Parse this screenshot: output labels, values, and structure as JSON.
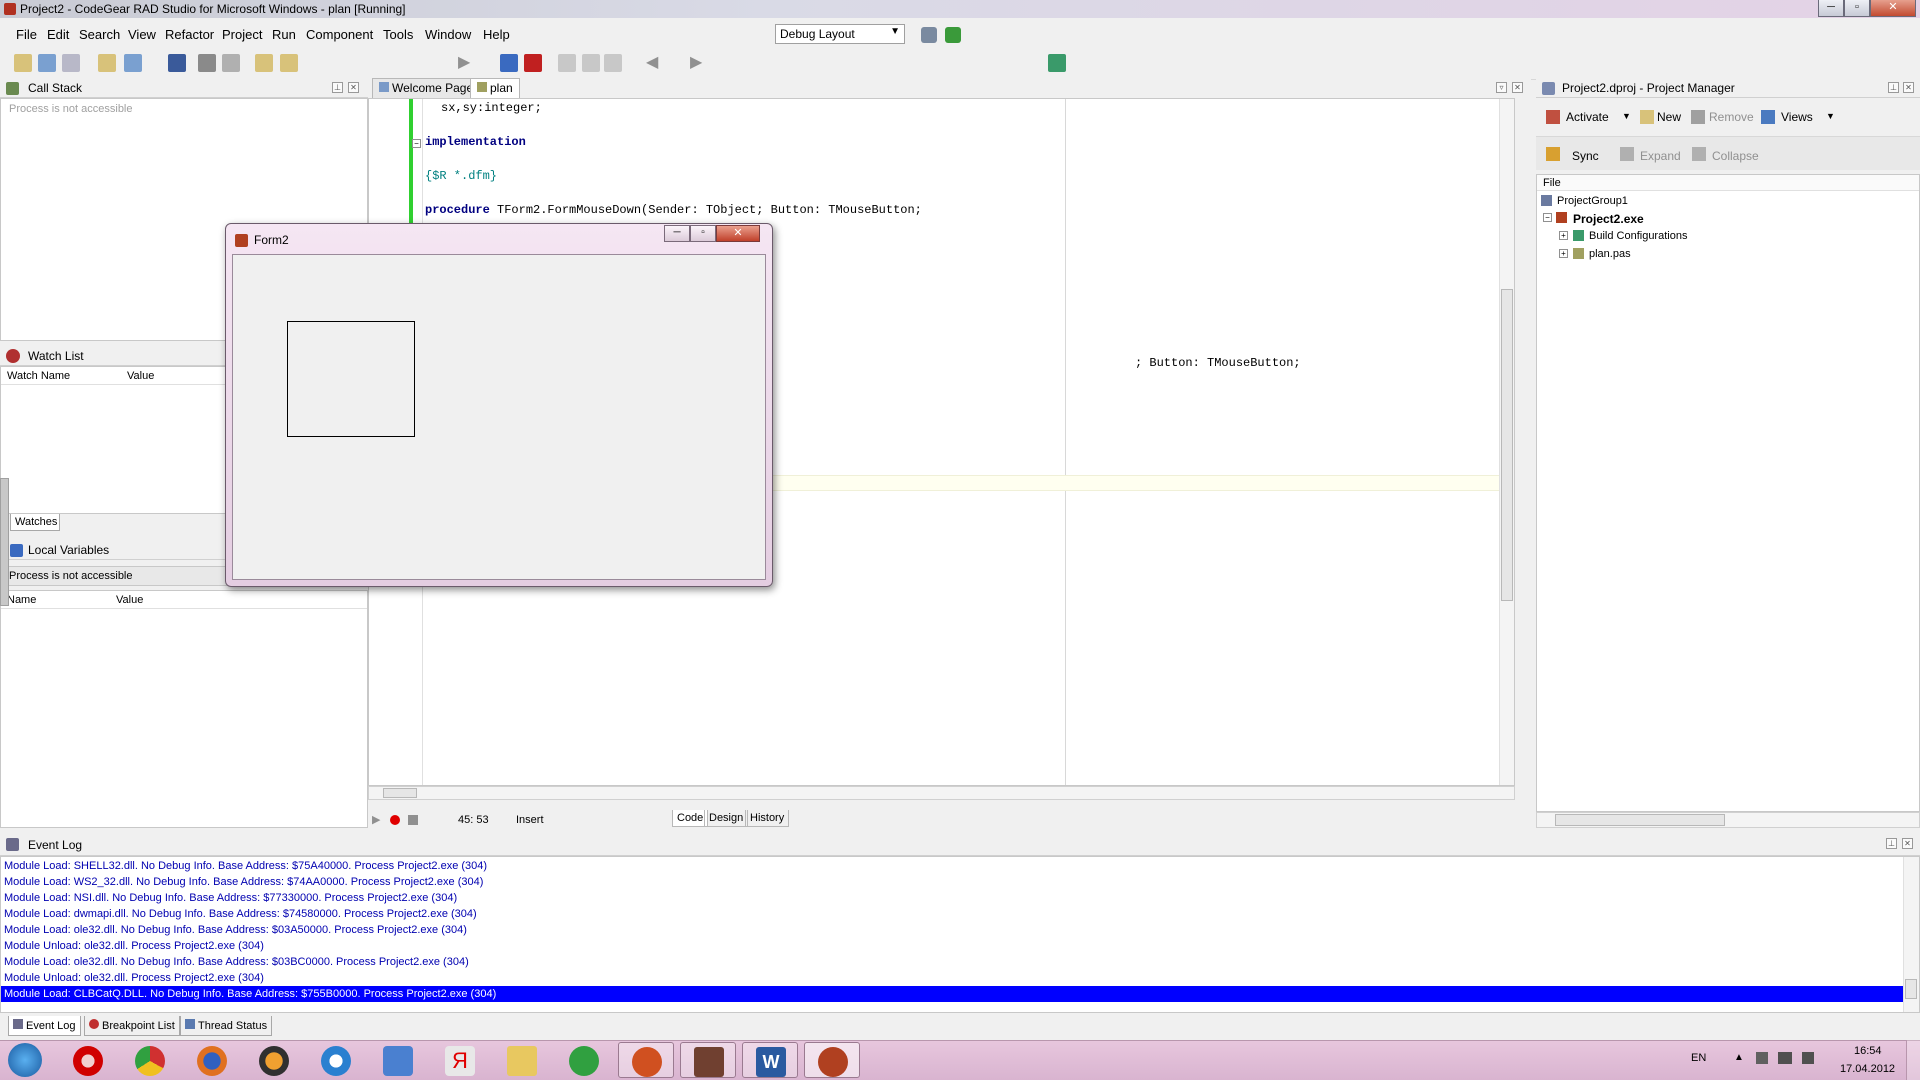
{
  "app": {
    "title": "Project2 - CodeGear RAD Studio for Microsoft Windows - plan [Running]"
  },
  "menu": [
    "File",
    "Edit",
    "Search",
    "View",
    "Refactor",
    "Project",
    "Run",
    "Component",
    "Tools",
    "Window",
    "Help"
  ],
  "toolbar": {
    "layout_select": "Debug Layout"
  },
  "call_stack": {
    "title": "Call Stack",
    "status": "Process is not accessible"
  },
  "watch_list": {
    "title": "Watch List",
    "columns": [
      "Watch Name",
      "Value"
    ],
    "tab": "Watches"
  },
  "local_vars": {
    "title": "Local Variables",
    "status": "Process is not accessible",
    "columns": [
      "Name",
      "Value"
    ]
  },
  "editor": {
    "tabs": [
      "Welcome Page",
      "plan"
    ],
    "code": {
      "line1": "sx,sy:integer;",
      "line2": "implementation",
      "line3": "{$R *.dfm}",
      "line4_kw": "procedure",
      "line4_rest": " TForm2.FormMouseDown(Sender: TObject; Button: TMouseButton;",
      "line5": "; Button: TMouseButton;"
    },
    "status": {
      "position": "45: 53",
      "mode": "Insert"
    },
    "view_tabs": [
      "Code",
      "Design",
      "History"
    ]
  },
  "form2": {
    "title": "Form2"
  },
  "project_manager": {
    "title": "Project2.dproj - Project Manager",
    "buttons": [
      "Activate",
      "New",
      "Remove",
      "Views"
    ],
    "buttons2": [
      "Sync",
      "Expand",
      "Collapse"
    ],
    "column": "File",
    "tree": [
      "ProjectGroup1",
      "Project2.exe",
      "Build Configurations",
      "plan.pas"
    ]
  },
  "event_log": {
    "title": "Event Log",
    "lines": [
      "Module Load: SHELL32.dll. No Debug Info. Base Address: $75A40000. Process Project2.exe (304)",
      "Module Load: WS2_32.dll. No Debug Info. Base Address: $74AA0000. Process Project2.exe (304)",
      "Module Load: NSI.dll. No Debug Info. Base Address: $77330000. Process Project2.exe (304)",
      "Module Load: dwmapi.dll. No Debug Info. Base Address: $74580000. Process Project2.exe (304)",
      "Module Load: ole32.dll. No Debug Info. Base Address: $03A50000. Process Project2.exe (304)",
      "Module Unload: ole32.dll. Process Project2.exe (304)",
      "Module Load: ole32.dll. No Debug Info. Base Address: $03BC0000. Process Project2.exe (304)",
      "Module Unload: ole32.dll. Process Project2.exe (304)",
      "Module Load: CLBCatQ.DLL. No Debug Info. Base Address: $755B0000. Process Project2.exe (304)"
    ],
    "tabs": [
      "Event Log",
      "Breakpoint List",
      "Thread Status"
    ]
  },
  "taskbar": {
    "lang": "EN",
    "time": "16:54",
    "date": "17.04.2012"
  },
  "colors": {
    "selection": "#0000ff",
    "log_text": "#0000b0",
    "keyword": "#000080",
    "comment": "#008080"
  }
}
